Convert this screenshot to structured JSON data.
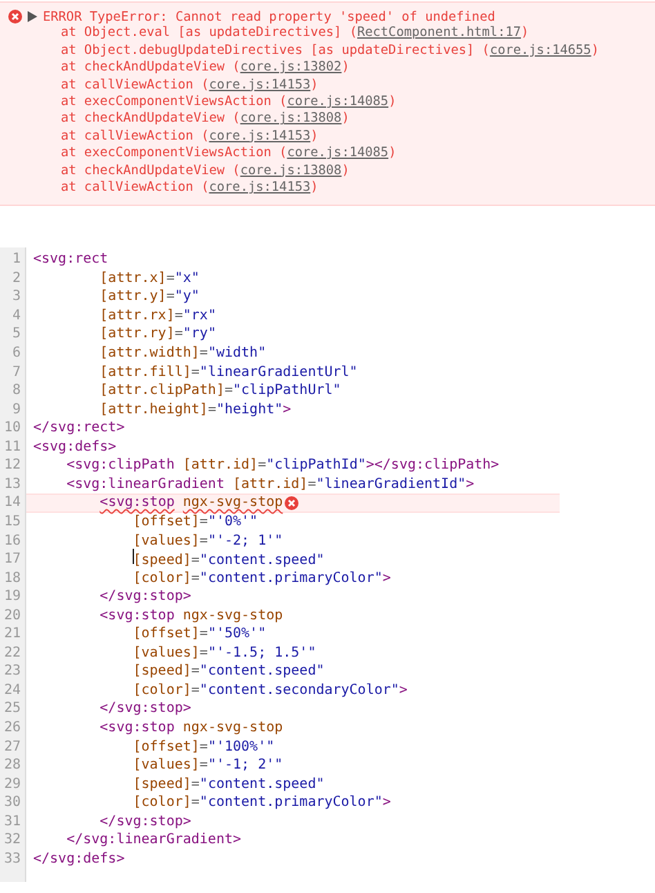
{
  "console_error": {
    "message": "ERROR TypeError: Cannot read property 'speed' of undefined",
    "expanded": true,
    "stack": [
      {
        "call": "at Object.eval [as updateDirectives] (",
        "source": "RectComponent.html:17",
        "end": ")"
      },
      {
        "call": "at Object.debugUpdateDirectives [as updateDirectives] (",
        "source": "core.js:14655",
        "end": ")"
      },
      {
        "call": "at checkAndUpdateView (",
        "source": "core.js:13802",
        "end": ")"
      },
      {
        "call": "at callViewAction (",
        "source": "core.js:14153",
        "end": ")"
      },
      {
        "call": "at execComponentViewsAction (",
        "source": "core.js:14085",
        "end": ")"
      },
      {
        "call": "at checkAndUpdateView (",
        "source": "core.js:13808",
        "end": ")"
      },
      {
        "call": "at callViewAction (",
        "source": "core.js:14153",
        "end": ")"
      },
      {
        "call": "at execComponentViewsAction (",
        "source": "core.js:14085",
        "end": ")"
      },
      {
        "call": "at checkAndUpdateView (",
        "source": "core.js:13808",
        "end": ")"
      },
      {
        "call": "at callViewAction (",
        "source": "core.js:14153",
        "end": ")"
      }
    ]
  },
  "editor": {
    "lines": [
      {
        "number": "1",
        "error": false,
        "cursor": false,
        "tokens": [
          {
            "kind": "tag",
            "text": "<svg:rect"
          }
        ]
      },
      {
        "number": "2",
        "error": false,
        "cursor": false,
        "tokens": [
          {
            "kind": "attr",
            "text": "        [attr.x]"
          },
          {
            "kind": "punct",
            "text": "="
          },
          {
            "kind": "value",
            "text": "\"x\""
          }
        ]
      },
      {
        "number": "3",
        "error": false,
        "cursor": false,
        "tokens": [
          {
            "kind": "attr",
            "text": "        [attr.y]"
          },
          {
            "kind": "punct",
            "text": "="
          },
          {
            "kind": "value",
            "text": "\"y\""
          }
        ]
      },
      {
        "number": "4",
        "error": false,
        "cursor": false,
        "tokens": [
          {
            "kind": "attr",
            "text": "        [attr.rx]"
          },
          {
            "kind": "punct",
            "text": "="
          },
          {
            "kind": "value",
            "text": "\"rx\""
          }
        ]
      },
      {
        "number": "5",
        "error": false,
        "cursor": false,
        "tokens": [
          {
            "kind": "attr",
            "text": "        [attr.ry]"
          },
          {
            "kind": "punct",
            "text": "="
          },
          {
            "kind": "value",
            "text": "\"ry\""
          }
        ]
      },
      {
        "number": "6",
        "error": false,
        "cursor": false,
        "tokens": [
          {
            "kind": "attr",
            "text": "        [attr.width]"
          },
          {
            "kind": "punct",
            "text": "="
          },
          {
            "kind": "value",
            "text": "\"width\""
          }
        ]
      },
      {
        "number": "7",
        "error": false,
        "cursor": false,
        "tokens": [
          {
            "kind": "attr",
            "text": "        [attr.fill]"
          },
          {
            "kind": "punct",
            "text": "="
          },
          {
            "kind": "value",
            "text": "\"linearGradientUrl\""
          }
        ]
      },
      {
        "number": "8",
        "error": false,
        "cursor": false,
        "tokens": [
          {
            "kind": "attr",
            "text": "        [attr.clipPath]"
          },
          {
            "kind": "punct",
            "text": "="
          },
          {
            "kind": "value",
            "text": "\"clipPathUrl\""
          }
        ]
      },
      {
        "number": "9",
        "error": false,
        "cursor": false,
        "tokens": [
          {
            "kind": "attr",
            "text": "        [attr.height]"
          },
          {
            "kind": "punct",
            "text": "="
          },
          {
            "kind": "value",
            "text": "\"height\""
          },
          {
            "kind": "tag",
            "text": ">"
          }
        ]
      },
      {
        "number": "10",
        "error": false,
        "cursor": false,
        "tokens": [
          {
            "kind": "tag",
            "text": "</svg:rect>"
          }
        ]
      },
      {
        "number": "11",
        "error": false,
        "cursor": false,
        "tokens": [
          {
            "kind": "tag",
            "text": "<svg:defs>"
          }
        ]
      },
      {
        "number": "12",
        "error": false,
        "cursor": false,
        "tokens": [
          {
            "kind": "tag",
            "text": "    <svg:clipPath"
          },
          {
            "kind": "attr",
            "text": " [attr.id]"
          },
          {
            "kind": "punct",
            "text": "="
          },
          {
            "kind": "value",
            "text": "\"clipPathId\""
          },
          {
            "kind": "tag",
            "text": "></svg:clipPath>"
          }
        ]
      },
      {
        "number": "13",
        "error": false,
        "cursor": false,
        "tokens": [
          {
            "kind": "tag",
            "text": "    <svg:linearGradient"
          },
          {
            "kind": "attr",
            "text": " [attr.id]"
          },
          {
            "kind": "punct",
            "text": "="
          },
          {
            "kind": "value",
            "text": "\"linearGradientId\""
          },
          {
            "kind": "tag",
            "text": ">"
          }
        ]
      },
      {
        "number": "14",
        "error": true,
        "cursor": false,
        "tokens": [
          {
            "kind": "tag",
            "text": "        <svg:stop"
          },
          {
            "kind": "attr",
            "text": " ngx-svg-stop"
          }
        ]
      },
      {
        "number": "15",
        "error": false,
        "cursor": false,
        "tokens": [
          {
            "kind": "attr",
            "text": "            [offset]"
          },
          {
            "kind": "punct",
            "text": "="
          },
          {
            "kind": "value",
            "text": "\"'0%'\""
          }
        ]
      },
      {
        "number": "16",
        "error": false,
        "cursor": false,
        "tokens": [
          {
            "kind": "attr",
            "text": "            [values]"
          },
          {
            "kind": "punct",
            "text": "="
          },
          {
            "kind": "value",
            "text": "\"'-2; 1'\""
          }
        ]
      },
      {
        "number": "17",
        "error": false,
        "cursor": true,
        "tokens": [
          {
            "kind": "attr",
            "text": "            [speed]"
          },
          {
            "kind": "punct",
            "text": "="
          },
          {
            "kind": "value",
            "text": "\"content.speed\""
          }
        ]
      },
      {
        "number": "18",
        "error": false,
        "cursor": false,
        "tokens": [
          {
            "kind": "attr",
            "text": "            [color]"
          },
          {
            "kind": "punct",
            "text": "="
          },
          {
            "kind": "value",
            "text": "\"content.primaryColor\""
          },
          {
            "kind": "tag",
            "text": ">"
          }
        ]
      },
      {
        "number": "19",
        "error": false,
        "cursor": false,
        "tokens": [
          {
            "kind": "tag",
            "text": "        </svg:stop>"
          }
        ]
      },
      {
        "number": "20",
        "error": false,
        "cursor": false,
        "tokens": [
          {
            "kind": "tag",
            "text": "        <svg:stop"
          },
          {
            "kind": "attr",
            "text": " ngx-svg-stop"
          }
        ]
      },
      {
        "number": "21",
        "error": false,
        "cursor": false,
        "tokens": [
          {
            "kind": "attr",
            "text": "            [offset]"
          },
          {
            "kind": "punct",
            "text": "="
          },
          {
            "kind": "value",
            "text": "\"'50%'\""
          }
        ]
      },
      {
        "number": "22",
        "error": false,
        "cursor": false,
        "tokens": [
          {
            "kind": "attr",
            "text": "            [values]"
          },
          {
            "kind": "punct",
            "text": "="
          },
          {
            "kind": "value",
            "text": "\"'-1.5; 1.5'\""
          }
        ]
      },
      {
        "number": "23",
        "error": false,
        "cursor": false,
        "tokens": [
          {
            "kind": "attr",
            "text": "            [speed]"
          },
          {
            "kind": "punct",
            "text": "="
          },
          {
            "kind": "value",
            "text": "\"content.speed\""
          }
        ]
      },
      {
        "number": "24",
        "error": false,
        "cursor": false,
        "tokens": [
          {
            "kind": "attr",
            "text": "            [color]"
          },
          {
            "kind": "punct",
            "text": "="
          },
          {
            "kind": "value",
            "text": "\"content.secondaryColor\""
          },
          {
            "kind": "tag",
            "text": ">"
          }
        ]
      },
      {
        "number": "25",
        "error": false,
        "cursor": false,
        "tokens": [
          {
            "kind": "tag",
            "text": "        </svg:stop>"
          }
        ]
      },
      {
        "number": "26",
        "error": false,
        "cursor": false,
        "tokens": [
          {
            "kind": "tag",
            "text": "        <svg:stop"
          },
          {
            "kind": "attr",
            "text": " ngx-svg-stop"
          }
        ]
      },
      {
        "number": "27",
        "error": false,
        "cursor": false,
        "tokens": [
          {
            "kind": "attr",
            "text": "            [offset]"
          },
          {
            "kind": "punct",
            "text": "="
          },
          {
            "kind": "value",
            "text": "\"'100%'\""
          }
        ]
      },
      {
        "number": "28",
        "error": false,
        "cursor": false,
        "tokens": [
          {
            "kind": "attr",
            "text": "            [values]"
          },
          {
            "kind": "punct",
            "text": "="
          },
          {
            "kind": "value",
            "text": "\"'-1; 2'\""
          }
        ]
      },
      {
        "number": "29",
        "error": false,
        "cursor": false,
        "tokens": [
          {
            "kind": "attr",
            "text": "            [speed]"
          },
          {
            "kind": "punct",
            "text": "="
          },
          {
            "kind": "value",
            "text": "\"content.speed\""
          }
        ]
      },
      {
        "number": "30",
        "error": false,
        "cursor": false,
        "tokens": [
          {
            "kind": "attr",
            "text": "            [color]"
          },
          {
            "kind": "punct",
            "text": "="
          },
          {
            "kind": "value",
            "text": "\"content.primaryColor\""
          },
          {
            "kind": "tag",
            "text": ">"
          }
        ]
      },
      {
        "number": "31",
        "error": false,
        "cursor": false,
        "tokens": [
          {
            "kind": "tag",
            "text": "        </svg:stop>"
          }
        ]
      },
      {
        "number": "32",
        "error": false,
        "cursor": false,
        "tokens": [
          {
            "kind": "tag",
            "text": "    </svg:linearGradient>"
          }
        ]
      },
      {
        "number": "33",
        "error": false,
        "cursor": false,
        "tokens": [
          {
            "kind": "tag",
            "text": "</svg:defs>"
          }
        ]
      }
    ]
  }
}
